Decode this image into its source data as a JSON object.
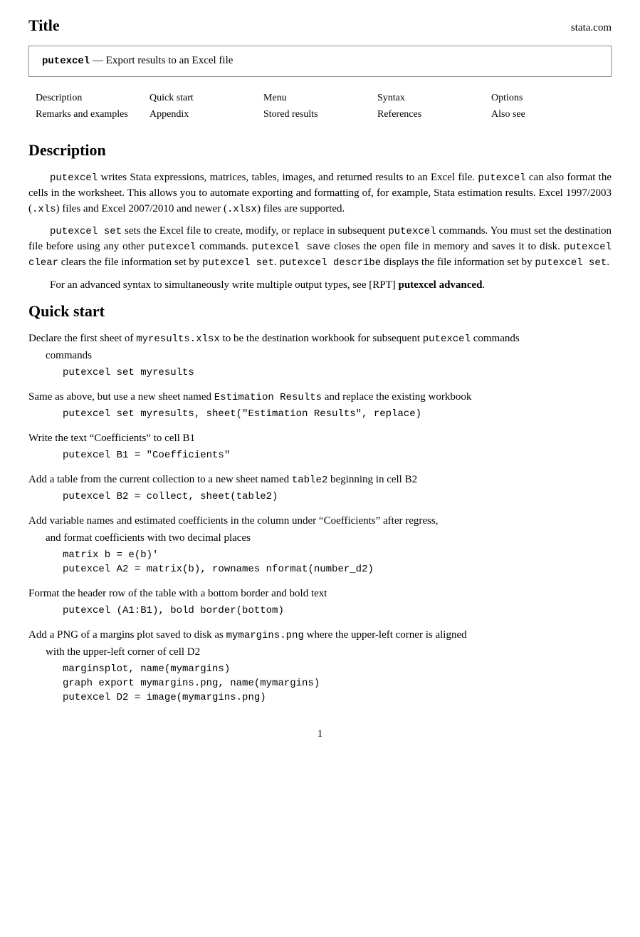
{
  "header": {
    "title": "Title",
    "domain": "stata.com"
  },
  "command_box": {
    "cmd": "putexcel",
    "dash": "—",
    "description": "Export results to an Excel file"
  },
  "nav": {
    "col1": [
      "Description",
      "Remarks and examples"
    ],
    "col2": [
      "Quick start",
      "Appendix"
    ],
    "col3": [
      "Menu",
      "Stored results"
    ],
    "col4": [
      "Syntax",
      "References"
    ],
    "col5": [
      "Options",
      "Also see"
    ]
  },
  "description_section": {
    "heading": "Description",
    "paragraphs": [
      "putexcel writes Stata expressions, matrices, tables, images, and returned results to an Excel file. putexcel can also format the cells in the worksheet. This allows you to automate exporting and formatting of, for example, Stata estimation results. Excel 1997/2003 (.xls) files and Excel 2007/2010 and newer (.xlsx) files are supported.",
      "putexcel set sets the Excel file to create, modify, or replace in subsequent putexcel commands. You must set the destination file before using any other putexcel commands. putexcel save closes the open file in memory and saves it to disk. putexcel clear clears the file information set by putexcel set. putexcel describe displays the file information set by putexcel set.",
      "For an advanced syntax to simultaneously write multiple output types, see [RPT] putexcel advanced."
    ]
  },
  "quickstart_section": {
    "heading": "Quick start",
    "items": [
      {
        "desc": "Declare the first sheet of myresults.xlsx to be the destination workbook for subsequent putexcel commands",
        "code_lines": [
          "putexcel set myresults"
        ]
      },
      {
        "desc": "Same as above, but use a new sheet named Estimation Results and replace the existing workbook",
        "code_lines": [
          "putexcel set myresults, sheet(\"Estimation Results\", replace)"
        ]
      },
      {
        "desc": "Write the text “Coefficients” to cell B1",
        "code_lines": [
          "putexcel B1 = \"Coefficients\""
        ]
      },
      {
        "desc": "Add a table from the current collection to a new sheet named table2 beginning in cell B2",
        "code_lines": [
          "putexcel B2 = collect, sheet(table2)"
        ]
      },
      {
        "desc": "Add variable names and estimated coefficients in the column under “Coefficients” after regress, and format coefficients with two decimal places",
        "code_lines": [
          "matrix b = e(b)'",
          "putexcel A2 = matrix(b), rownames nformat(number_d2)"
        ]
      },
      {
        "desc": "Format the header row of the table with a bottom border and bold text",
        "code_lines": [
          "putexcel (A1:B1), bold border(bottom)"
        ]
      },
      {
        "desc": "Add a PNG of a margins plot saved to disk as mymargins.png where the upper-left corner is aligned with the upper-left corner of cell D2",
        "code_lines": [
          "marginsplot, name(mymargins)",
          "graph export mymargins.png, name(mymargins)",
          "putexcel D2 = image(mymargins.png)"
        ]
      }
    ]
  },
  "footer": {
    "page_number": "1"
  }
}
